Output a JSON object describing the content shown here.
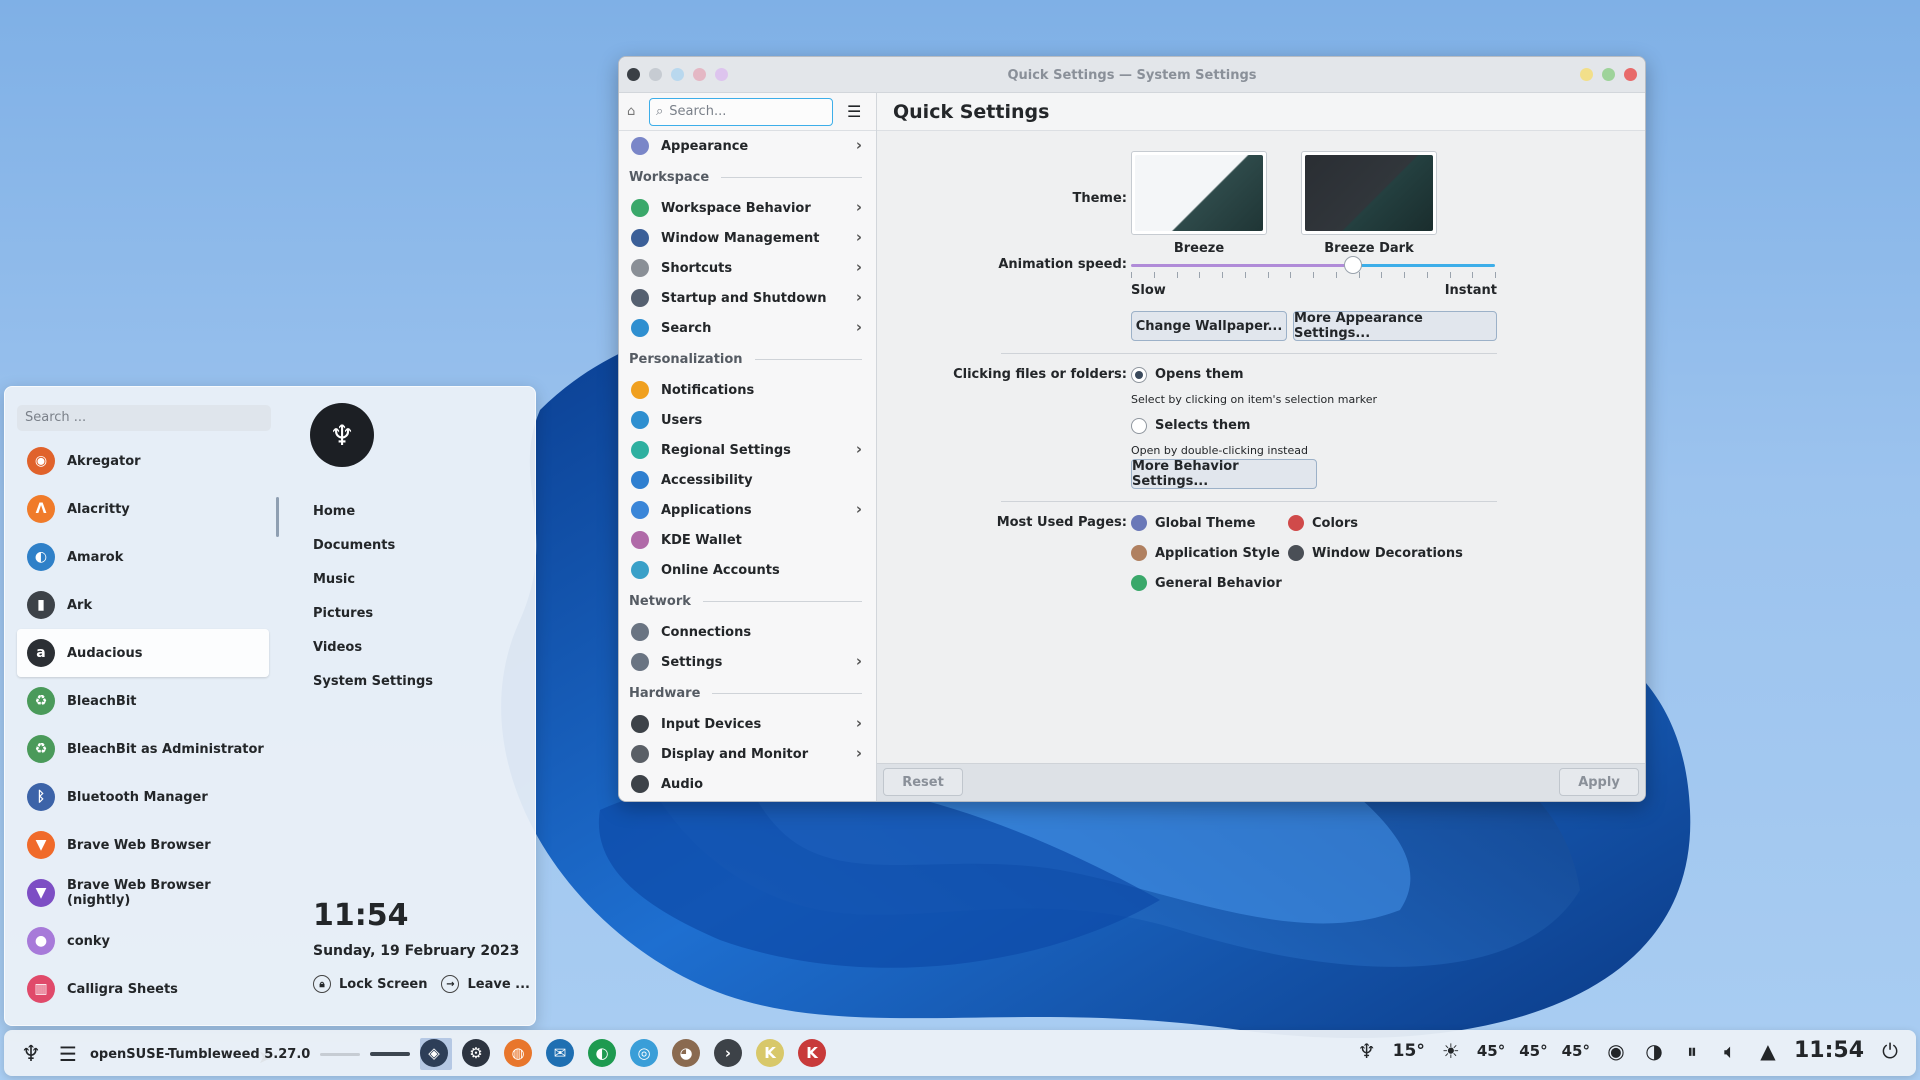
{
  "launcher": {
    "search_placeholder": "Search ...",
    "apps": [
      {
        "label": "Akregator",
        "icon": "akregator-icon",
        "color": "#e0622b",
        "glyph": "◉"
      },
      {
        "label": "Alacritty",
        "icon": "alacritty-icon",
        "color": "#f07b2a",
        "glyph": "Λ"
      },
      {
        "label": "Amarok",
        "icon": "amarok-icon",
        "color": "#2f80c8",
        "glyph": "◐"
      },
      {
        "label": "Ark",
        "icon": "ark-icon",
        "color": "#3d4248",
        "glyph": "▮"
      },
      {
        "label": "Audacious",
        "icon": "audacious-icon",
        "color": "#2b2f34",
        "glyph": "a"
      },
      {
        "label": "BleachBit",
        "icon": "bleachbit-icon",
        "color": "#4a9a5a",
        "glyph": "♻"
      },
      {
        "label": "BleachBit as Administrator",
        "icon": "bleachbit-admin-icon",
        "color": "#4a9a5a",
        "glyph": "♻"
      },
      {
        "label": "Bluetooth Manager",
        "icon": "bluetooth-icon",
        "color": "#3c63a8",
        "glyph": "ᛒ"
      },
      {
        "label": "Brave Web Browser",
        "icon": "brave-icon",
        "color": "#f06a2a",
        "glyph": "▼"
      },
      {
        "label": "Brave Web Browser (nightly)",
        "icon": "brave-nightly-icon",
        "color": "#7d4ec4",
        "glyph": "▼"
      },
      {
        "label": "conky",
        "icon": "conky-icon",
        "color": "#a77ad9",
        "glyph": "●"
      },
      {
        "label": "Calligra Sheets",
        "icon": "calligra-sheets-icon",
        "color": "#e04a6a",
        "glyph": "▥"
      }
    ],
    "places": [
      "Home",
      "Documents",
      "Music",
      "Pictures",
      "Videos",
      "System Settings"
    ],
    "time": "11:54",
    "date": "Sunday, 19 February 2023",
    "lock_label": "Lock Screen",
    "leave_label": "Leave ..."
  },
  "window": {
    "title": "Quick Settings — System Settings",
    "search_placeholder": "Search...",
    "page_title": "Quick Settings",
    "sidebar": {
      "top": {
        "label": "Appearance",
        "color": "#7a86c8"
      },
      "sections": [
        {
          "header": "Workspace",
          "items": [
            {
              "label": "Workspace Behavior",
              "chevron": true,
              "color": "#3aa86a"
            },
            {
              "label": "Window Management",
              "chevron": true,
              "color": "#3b5f98"
            },
            {
              "label": "Shortcuts",
              "chevron": true,
              "color": "#8a8f96"
            },
            {
              "label": "Startup and Shutdown",
              "chevron": true,
              "color": "#556070"
            },
            {
              "label": "Search",
              "chevron": true,
              "color": "#2f8fd0"
            }
          ]
        },
        {
          "header": "Personalization",
          "items": [
            {
              "label": "Notifications",
              "chevron": false,
              "color": "#f0a020"
            },
            {
              "label": "Users",
              "chevron": false,
              "color": "#2f8fd0"
            },
            {
              "label": "Regional Settings",
              "chevron": true,
              "color": "#2fb0a0"
            },
            {
              "label": "Accessibility",
              "chevron": false,
              "color": "#2f7fd0"
            },
            {
              "label": "Applications",
              "chevron": true,
              "color": "#3b86d8"
            },
            {
              "label": "KDE Wallet",
              "chevron": false,
              "color": "#b06aa8"
            },
            {
              "label": "Online Accounts",
              "chevron": false,
              "color": "#3aa0c8"
            }
          ]
        },
        {
          "header": "Network",
          "items": [
            {
              "label": "Connections",
              "chevron": false,
              "color": "#6a7482"
            },
            {
              "label": "Settings",
              "chevron": true,
              "color": "#6a7482"
            }
          ]
        },
        {
          "header": "Hardware",
          "items": [
            {
              "label": "Input Devices",
              "chevron": true,
              "color": "#3d4248"
            },
            {
              "label": "Display and Monitor",
              "chevron": true,
              "color": "#5a5f66"
            },
            {
              "label": "Audio",
              "chevron": false,
              "color": "#3d4248"
            }
          ]
        }
      ]
    },
    "content": {
      "theme_label": "Theme:",
      "themes": [
        "Breeze",
        "Breeze Dark"
      ],
      "animation_label": "Animation speed:",
      "slow": "Slow",
      "instant": "Instant",
      "animation_speed": 0.61,
      "change_wallpaper": "Change Wallpaper...",
      "more_appearance": "More Appearance Settings...",
      "clicking_label": "Clicking files or folders:",
      "opens_them": "Opens them",
      "opens_hint": "Select by clicking on item's selection marker",
      "selects_them": "Selects them",
      "selects_hint": "Open by double-clicking instead",
      "more_behavior": "More Behavior Settings...",
      "most_used_label": "Most Used Pages:",
      "most_used": [
        {
          "label": "Global Theme",
          "color": "#6a78b8"
        },
        {
          "label": "Colors",
          "color": "#d04a4a"
        },
        {
          "label": "Application Style",
          "color": "#b08060"
        },
        {
          "label": "Window Decorations",
          "color": "#4a4f56"
        },
        {
          "label": "General Behavior",
          "color": "#3aa86a"
        }
      ]
    },
    "reset": "Reset",
    "apply": "Apply"
  },
  "taskbar": {
    "window_title": "openSUSE-Tumbleweed 5.27.0",
    "weather_temp": "15°",
    "temps": [
      "45°",
      "45°",
      "45°"
    ],
    "time": "11:54",
    "apps": [
      {
        "name": "discover-icon",
        "color": "#2d3e58",
        "glyph": "◈"
      },
      {
        "name": "system-settings-icon",
        "color": "#2d3440",
        "glyph": "⚙"
      },
      {
        "name": "firefox-icon",
        "color": "#e8762c",
        "glyph": "◍"
      },
      {
        "name": "thunderbird-icon",
        "color": "#1f6fb2",
        "glyph": "✉"
      },
      {
        "name": "spotify-like-icon",
        "color": "#1e9a50",
        "glyph": "◐"
      },
      {
        "name": "store-icon",
        "color": "#3a9ed8",
        "glyph": "◎"
      },
      {
        "name": "gimp-icon",
        "color": "#8a6a50",
        "glyph": "◕"
      },
      {
        "name": "terminal-icon",
        "color": "#3d4248",
        "glyph": "›"
      },
      {
        "name": "kvantum-icon",
        "color": "#d8c86a",
        "glyph": "K"
      },
      {
        "name": "kvantum-manager-icon",
        "color": "#c83a3a",
        "glyph": "K"
      }
    ]
  }
}
